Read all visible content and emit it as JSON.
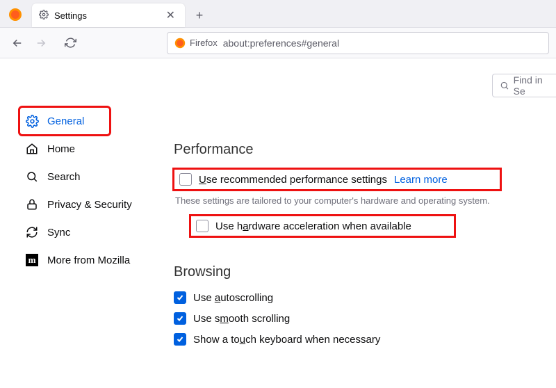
{
  "tab": {
    "title": "Settings"
  },
  "urlbar": {
    "identity": "Firefox",
    "url": "about:preferences#general"
  },
  "search": {
    "placeholder": "Find in Se"
  },
  "sidebar": {
    "items": [
      {
        "label": "General"
      },
      {
        "label": "Home"
      },
      {
        "label": "Search"
      },
      {
        "label": "Privacy & Security"
      },
      {
        "label": "Sync"
      },
      {
        "label": "More from Mozilla"
      }
    ]
  },
  "performance": {
    "title": "Performance",
    "recommended_prefix": "U",
    "recommended_rest": "se recommended performance settings",
    "learn_more": "Learn more",
    "hint": "These settings are tailored to your computer's hardware and operating system.",
    "hw_prefix": "Use h",
    "hw_u": "a",
    "hw_rest": "rdware acceleration when available"
  },
  "browsing": {
    "title": "Browsing",
    "auto_prefix": "Use ",
    "auto_u": "a",
    "auto_rest": "utoscrolling",
    "smooth_prefix": "Use s",
    "smooth_u": "m",
    "smooth_rest": "ooth scrolling",
    "touch_prefix": "Show a to",
    "touch_u": "u",
    "touch_rest": "ch keyboard when necessary"
  }
}
